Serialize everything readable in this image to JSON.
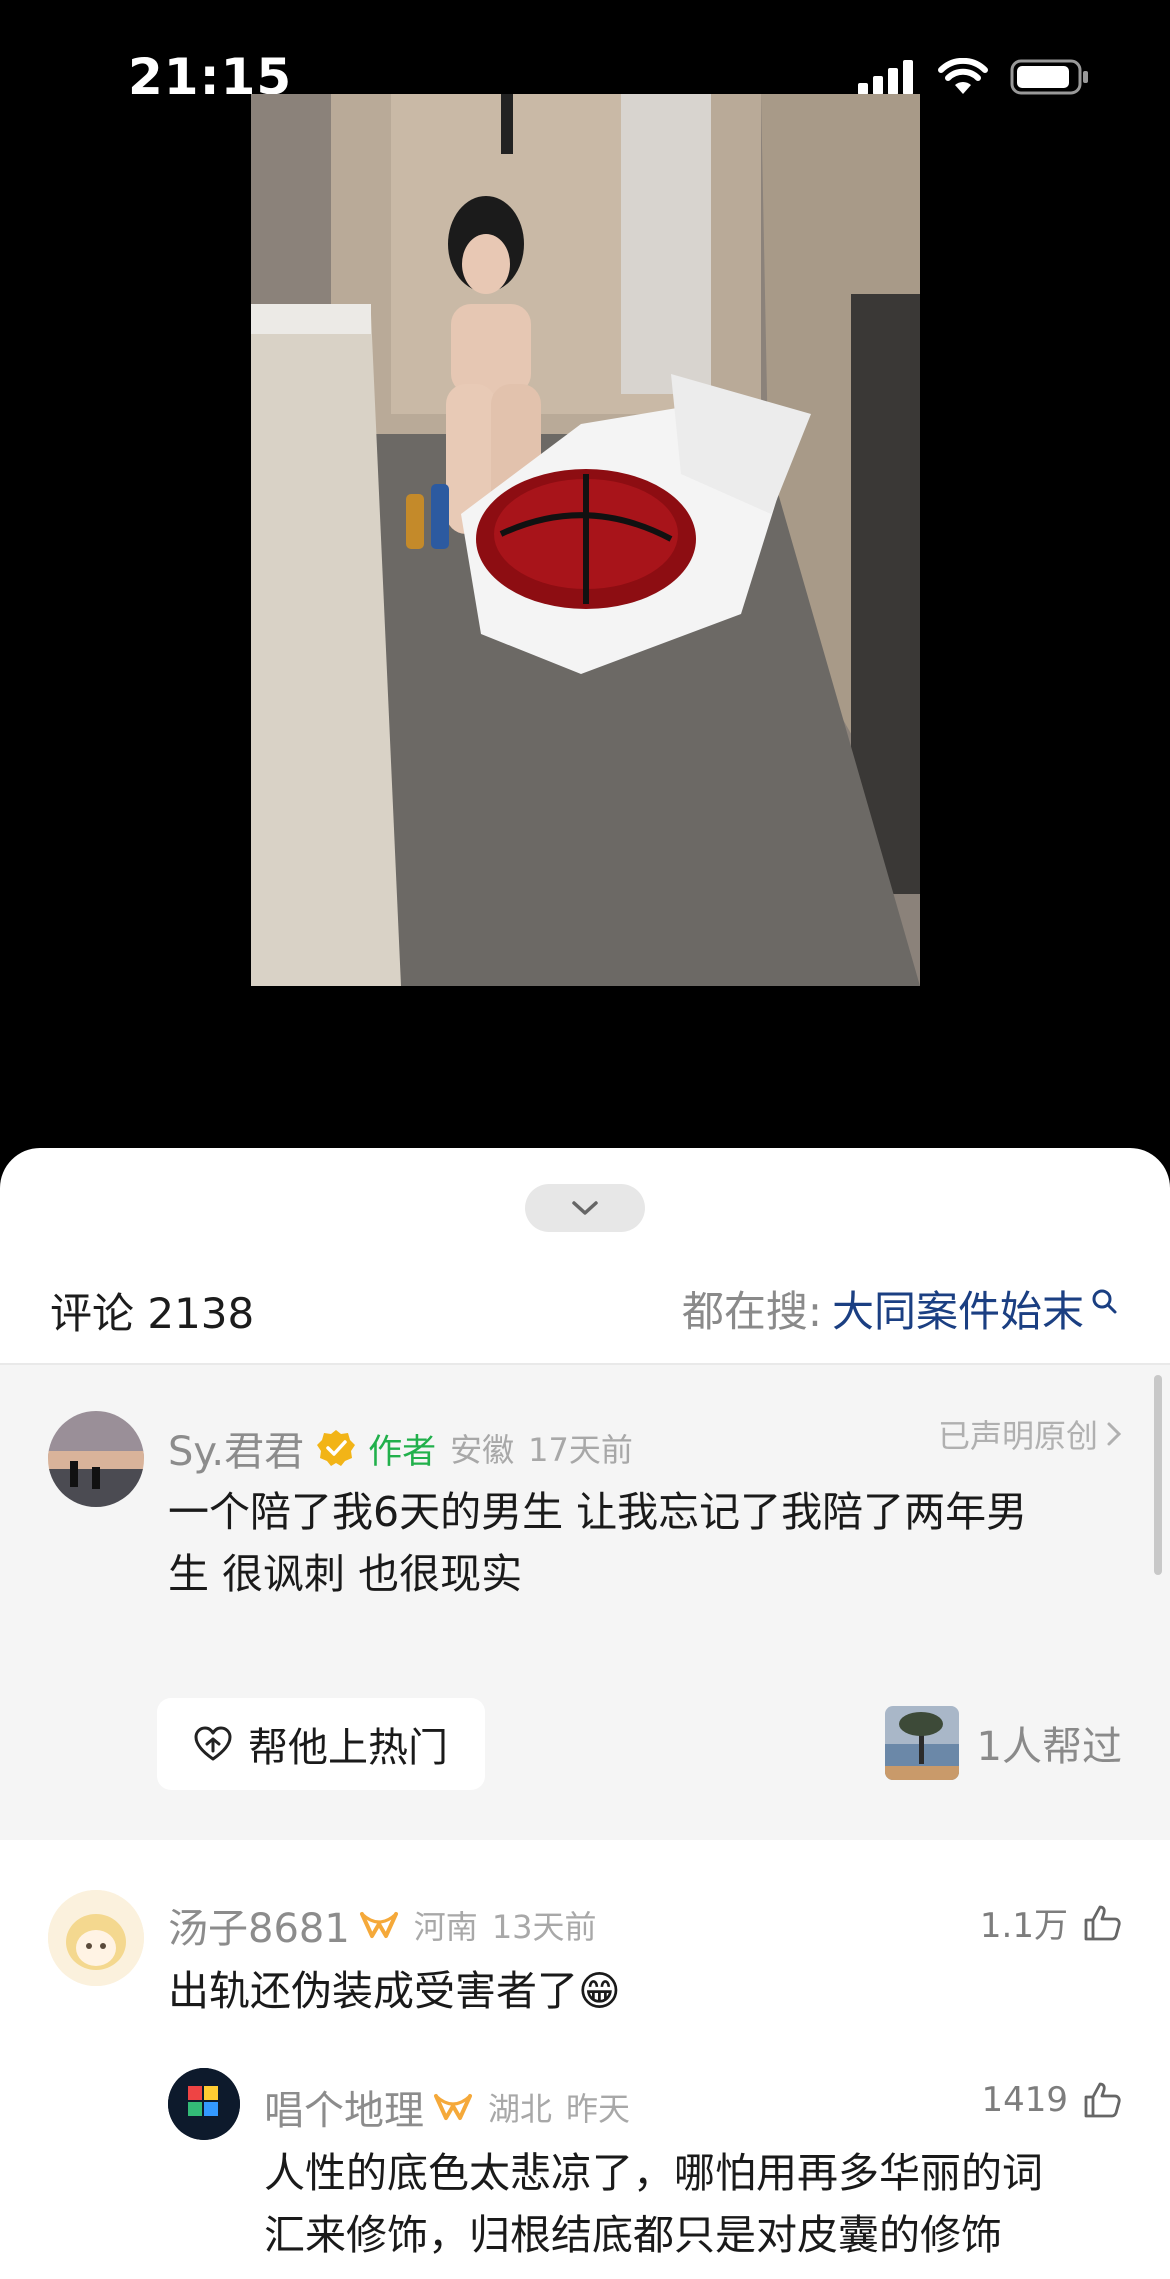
{
  "status_bar": {
    "time": "21:15"
  },
  "sheet": {
    "comment_count_label": "评论 2138",
    "hot_search_prefix": "都在搜:",
    "hot_search_term": "大同案件始末"
  },
  "pinned_comment": {
    "username": "Sy.君君",
    "author_badge": "作者",
    "location": "安徽",
    "time": "17天前",
    "original_claim": "已声明原创",
    "text_line1": "一个陪了我6天的男生 让我忘记了我陪了两年男",
    "text_line2": "生 很讽刺 也很现实",
    "boost_label": "帮他上热门",
    "helped_label": "1人帮过"
  },
  "comments": [
    {
      "username": "汤子8681",
      "location": "河南",
      "time": "13天前",
      "likes": "1.1万",
      "text": "出轨还伪装成受害者了😁"
    },
    {
      "username": "唱个地理",
      "location": "湖北",
      "time": "昨天",
      "likes": "1419",
      "text_line1": "人性的底色太悲凉了，哪怕用再多华丽的词",
      "text_line2": "汇来修饰，归根结底都只是对皮囊的修饰"
    }
  ],
  "colors": {
    "hot_search_term": "#1b3f82",
    "author_badge": "#21b04b",
    "verified_badge": "#f2b417",
    "vip_icon": "#f5a93a"
  }
}
